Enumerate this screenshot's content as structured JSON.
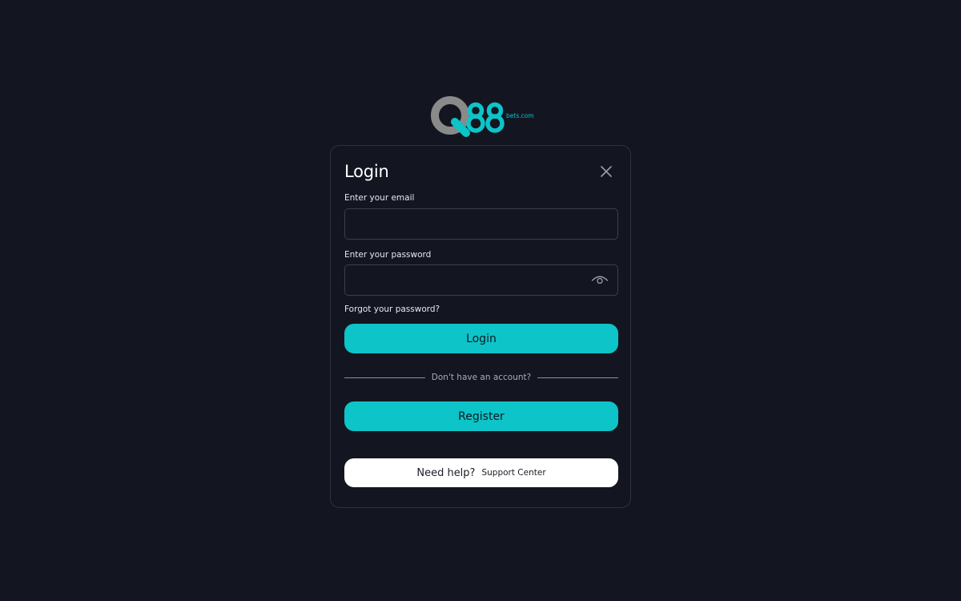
{
  "brand": {
    "logo_icon": "q88-logo",
    "logo_suffix": "bets.com",
    "colors": {
      "accent": "#0dc4c8",
      "logo_gray": "#8a8a8a",
      "background": "#131620"
    }
  },
  "modal": {
    "title": "Login",
    "close_icon": "close-icon"
  },
  "form": {
    "email_label": "Enter your email",
    "email_value": "",
    "password_label": "Enter your password",
    "password_value": "",
    "password_toggle_icon": "eye-icon",
    "forgot_link": "Forgot your password?",
    "login_button": "Login"
  },
  "divider": {
    "text": "Don't have an account?"
  },
  "register_button": "Register",
  "help": {
    "prompt": "Need help?",
    "link": "Support Center"
  }
}
